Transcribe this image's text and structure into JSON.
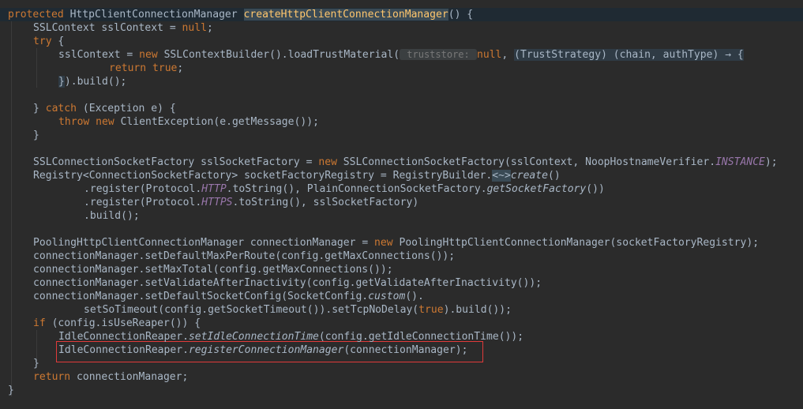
{
  "editor": {
    "highlight_color": "#e03a3a",
    "lines": [
      {
        "indent": 0,
        "tokens": [
          {
            "t": "protected ",
            "c": "k"
          },
          {
            "t": "HttpClientConnectionManager ",
            "c": "t"
          },
          {
            "t": "createHttpClientConnectionManager",
            "c": "fn hl"
          },
          {
            "t": "() {",
            "c": "t"
          }
        ]
      },
      {
        "indent": 1,
        "tokens": [
          {
            "t": "SSLContext ",
            "c": "t"
          },
          {
            "t": "sslContext",
            "c": "t"
          },
          {
            "t": " = ",
            "c": "t"
          },
          {
            "t": "null",
            "c": "k"
          },
          {
            "t": ";",
            "c": "t"
          }
        ]
      },
      {
        "indent": 1,
        "tokens": [
          {
            "t": "try",
            "c": "k"
          },
          {
            "t": " {",
            "c": "t"
          }
        ]
      },
      {
        "indent": 2,
        "tokens": [
          {
            "t": "sslContext",
            "c": "t"
          },
          {
            "t": " = ",
            "c": "t"
          },
          {
            "t": "new ",
            "c": "k"
          },
          {
            "t": "SSLContextBuilder().loadTrustMaterial(",
            "c": "t"
          },
          {
            "t": " truststore: ",
            "c": "hint"
          },
          {
            "t": "null",
            "c": "k"
          },
          {
            "t": ", ",
            "c": "t"
          },
          {
            "t": "(TrustStrategy) (chain, authType) → {",
            "c": "t lam"
          }
        ]
      },
      {
        "indent": 4,
        "tokens": [
          {
            "t": "return ",
            "c": "k"
          },
          {
            "t": "true",
            "c": "k"
          },
          {
            "t": ";",
            "c": "t"
          }
        ]
      },
      {
        "indent": 2,
        "tokens": [
          {
            "t": "}",
            "c": "t lam"
          },
          {
            "t": ").build();",
            "c": "t"
          }
        ]
      },
      {
        "indent": 0,
        "tokens": []
      },
      {
        "indent": 1,
        "tokens": [
          {
            "t": "} ",
            "c": "t"
          },
          {
            "t": "catch",
            "c": "k"
          },
          {
            "t": " (Exception e) {",
            "c": "t"
          }
        ]
      },
      {
        "indent": 2,
        "tokens": [
          {
            "t": "throw ",
            "c": "k"
          },
          {
            "t": "new ",
            "c": "k"
          },
          {
            "t": "ClientException(e.getMessage());",
            "c": "t"
          }
        ]
      },
      {
        "indent": 1,
        "tokens": [
          {
            "t": "}",
            "c": "t"
          }
        ]
      },
      {
        "indent": 0,
        "tokens": []
      },
      {
        "indent": 1,
        "tokens": [
          {
            "t": "SSLConnectionSocketFactory ",
            "c": "t"
          },
          {
            "t": "sslSocketFactory",
            "c": "t"
          },
          {
            "t": " = ",
            "c": "t"
          },
          {
            "t": "new ",
            "c": "k"
          },
          {
            "t": "SSLConnectionSocketFactory(sslContext, NoopHostnameVerifier.",
            "c": "t"
          },
          {
            "t": "INSTANCE",
            "c": "st"
          },
          {
            "t": ");",
            "c": "t"
          }
        ]
      },
      {
        "indent": 1,
        "tokens": [
          {
            "t": "Registry<ConnectionSocketFactory> ",
            "c": "t"
          },
          {
            "t": "socketFactoryRegistry",
            "c": "t"
          },
          {
            "t": " = RegistryBuilder.",
            "c": "t"
          },
          {
            "t": "<~>",
            "c": "t hl"
          },
          {
            "t": "create",
            "c": "t it"
          },
          {
            "t": "()",
            "c": "t"
          }
        ]
      },
      {
        "indent": 3,
        "tokens": [
          {
            "t": ".register(Protocol.",
            "c": "t"
          },
          {
            "t": "HTTP",
            "c": "st"
          },
          {
            "t": ".toString(), PlainConnectionSocketFactory.",
            "c": "t"
          },
          {
            "t": "getSocketFactory",
            "c": "t it"
          },
          {
            "t": "())",
            "c": "t"
          }
        ]
      },
      {
        "indent": 3,
        "tokens": [
          {
            "t": ".register(Protocol.",
            "c": "t"
          },
          {
            "t": "HTTPS",
            "c": "st"
          },
          {
            "t": ".toString(), sslSocketFactory)",
            "c": "t"
          }
        ]
      },
      {
        "indent": 3,
        "tokens": [
          {
            "t": ".build();",
            "c": "t"
          }
        ]
      },
      {
        "indent": 0,
        "tokens": []
      },
      {
        "indent": 1,
        "tokens": [
          {
            "t": "PoolingHttpClientConnectionManager ",
            "c": "t"
          },
          {
            "t": "connectionManager",
            "c": "t"
          },
          {
            "t": " = ",
            "c": "t"
          },
          {
            "t": "new ",
            "c": "k"
          },
          {
            "t": "PoolingHttpClientConnectionManager(socketFactoryRegistry);",
            "c": "t"
          }
        ]
      },
      {
        "indent": 1,
        "tokens": [
          {
            "t": "connectionManager.setDefaultMaxPerRoute(config.getMaxConnections());",
            "c": "t"
          }
        ]
      },
      {
        "indent": 1,
        "tokens": [
          {
            "t": "connectionManager.setMaxTotal(config.getMaxConnections());",
            "c": "t"
          }
        ]
      },
      {
        "indent": 1,
        "tokens": [
          {
            "t": "connectionManager.setValidateAfterInactivity(config.getValidateAfterInactivity());",
            "c": "t"
          }
        ]
      },
      {
        "indent": 1,
        "tokens": [
          {
            "t": "connectionManager.setDefaultSocketConfig(SocketConfig.",
            "c": "t"
          },
          {
            "t": "custom",
            "c": "t it"
          },
          {
            "t": "().",
            "c": "t"
          }
        ]
      },
      {
        "indent": 3,
        "tokens": [
          {
            "t": "setSoTimeout(config.getSocketTimeout()).setTcpNoDelay(",
            "c": "t"
          },
          {
            "t": "true",
            "c": "k"
          },
          {
            "t": ").build());",
            "c": "t"
          }
        ]
      },
      {
        "indent": 1,
        "tokens": [
          {
            "t": "if",
            "c": "k"
          },
          {
            "t": " (config.isUseReaper()) {",
            "c": "t"
          }
        ]
      },
      {
        "indent": 2,
        "tokens": [
          {
            "t": "IdleConnectionReaper.",
            "c": "t"
          },
          {
            "t": "setIdleConnectionTime",
            "c": "t it"
          },
          {
            "t": "(config.getIdleConnectionTime());",
            "c": "t"
          }
        ]
      },
      {
        "indent": 2,
        "tokens": [
          {
            "t": "IdleConnectionReaper.",
            "c": "t"
          },
          {
            "t": "registerConnectionManager",
            "c": "t it"
          },
          {
            "t": "(connectionManager);",
            "c": "t"
          }
        ]
      },
      {
        "indent": 1,
        "tokens": [
          {
            "t": "}",
            "c": "t"
          }
        ]
      },
      {
        "indent": 1,
        "tokens": [
          {
            "t": "return ",
            "c": "k"
          },
          {
            "t": "connectionManager;",
            "c": "t"
          }
        ]
      },
      {
        "indent": 0,
        "tokens": [
          {
            "t": "}",
            "c": "t"
          }
        ]
      }
    ]
  }
}
